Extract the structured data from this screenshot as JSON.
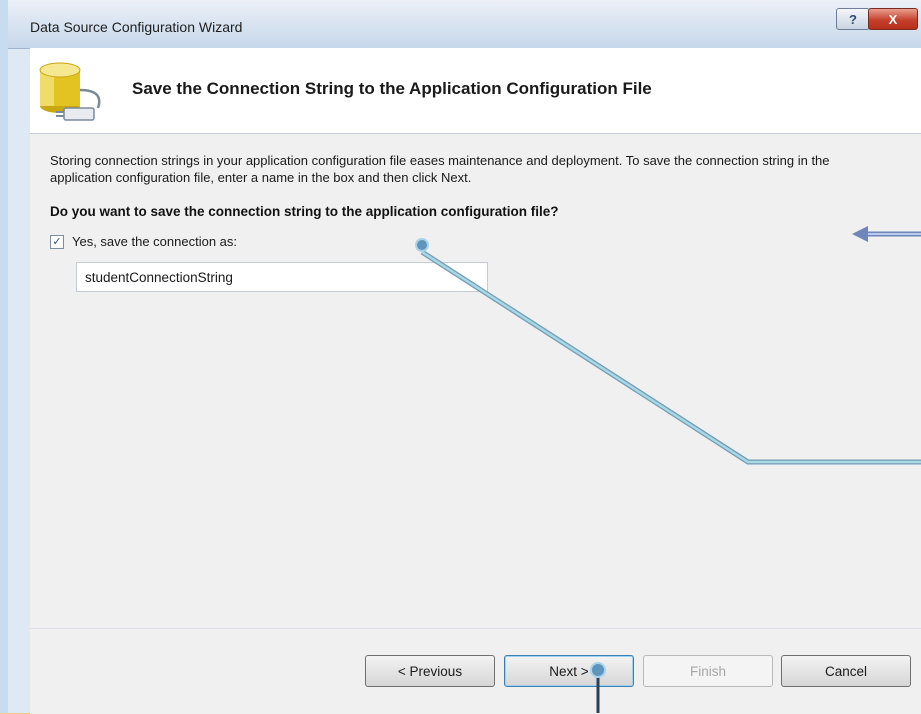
{
  "window": {
    "title": "Data Source Configuration Wizard",
    "help_glyph": "?",
    "close_glyph": "X"
  },
  "header": {
    "title": "Save the Connection String to the Application Configuration File",
    "icon": "database-plug-icon"
  },
  "content": {
    "description": "Storing connection strings in your application configuration file eases maintenance and deployment. To save the connection string in the application configuration file, enter a name in the box and then click Next.",
    "question": "Do you want to save the connection string to the application configuration file?",
    "save_checkbox": {
      "label": "Yes, save the connection as:",
      "checked": true,
      "check_glyph": "✓"
    },
    "connection_name": "studentConnectionString"
  },
  "buttons": {
    "previous": "< Previous",
    "next": "Next >",
    "finish": "Finish",
    "cancel": "Cancel"
  },
  "colors": {
    "frame": "#f2c896",
    "annotation_line": "#8fc3d6",
    "annotation_arrow": "#9bb7de"
  }
}
